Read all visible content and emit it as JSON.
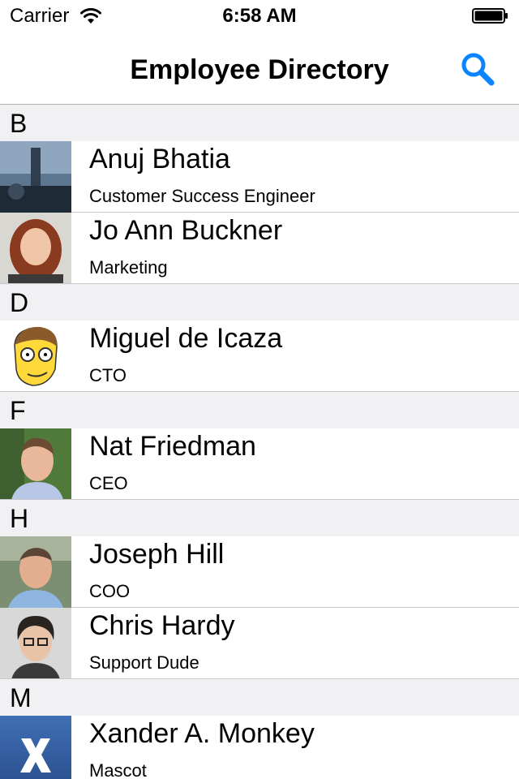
{
  "status_bar": {
    "carrier": "Carrier",
    "time": "6:58 AM"
  },
  "nav": {
    "title": "Employee Directory"
  },
  "sections": [
    {
      "letter": "B",
      "employees": [
        {
          "name": "Anuj Bhatia",
          "role": "Customer Success Engineer"
        },
        {
          "name": "Jo Ann Buckner",
          "role": "Marketing"
        }
      ]
    },
    {
      "letter": "D",
      "employees": [
        {
          "name": "Miguel de Icaza",
          "role": "CTO"
        }
      ]
    },
    {
      "letter": "F",
      "employees": [
        {
          "name": "Nat Friedman",
          "role": "CEO"
        }
      ]
    },
    {
      "letter": "H",
      "employees": [
        {
          "name": "Joseph Hill",
          "role": "COO"
        },
        {
          "name": "Chris Hardy",
          "role": "Support Dude"
        }
      ]
    },
    {
      "letter": "M",
      "employees": [
        {
          "name": "Xander A. Monkey",
          "role": "Mascot"
        }
      ]
    }
  ],
  "colors": {
    "accent": "#0a84ff",
    "section_bg": "#f1f1f3",
    "separator": "#c8c7cc"
  }
}
